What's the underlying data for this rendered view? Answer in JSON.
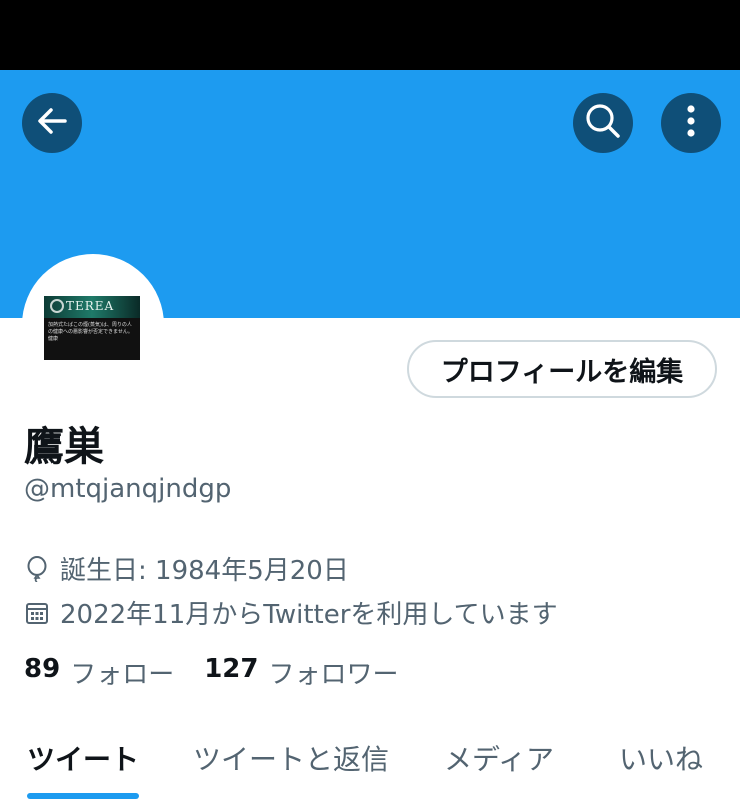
{
  "header": {
    "back_icon": "arrow-left-icon",
    "search_icon": "search-icon",
    "more_icon": "more-vertical-icon"
  },
  "colors": {
    "banner": "#1d9bf0",
    "accent": "#1d9bf0",
    "header_button_bg": "#0f4f78",
    "secondary_text": "#536471"
  },
  "profile": {
    "avatar_brand": "TEREA",
    "avatar_caption": "加熱式たばこの煙(蒸気)は、周りの人の健康への悪影響が否定できません。健康",
    "edit_button": "プロフィールを編集",
    "name": "鷹巣",
    "handle": "@mtqjanqjndgp",
    "birthday": "誕生日: 1984年5月20日",
    "joined": "2022年11月からTwitterを利用しています",
    "following_count": "89",
    "following_label": "フォロー",
    "followers_count": "127",
    "followers_label": "フォロワー"
  },
  "tabs": [
    {
      "label": "ツイート",
      "active": true
    },
    {
      "label": "ツイートと返信",
      "active": false
    },
    {
      "label": "メディア",
      "active": false
    },
    {
      "label": "いいね",
      "active": false
    }
  ]
}
